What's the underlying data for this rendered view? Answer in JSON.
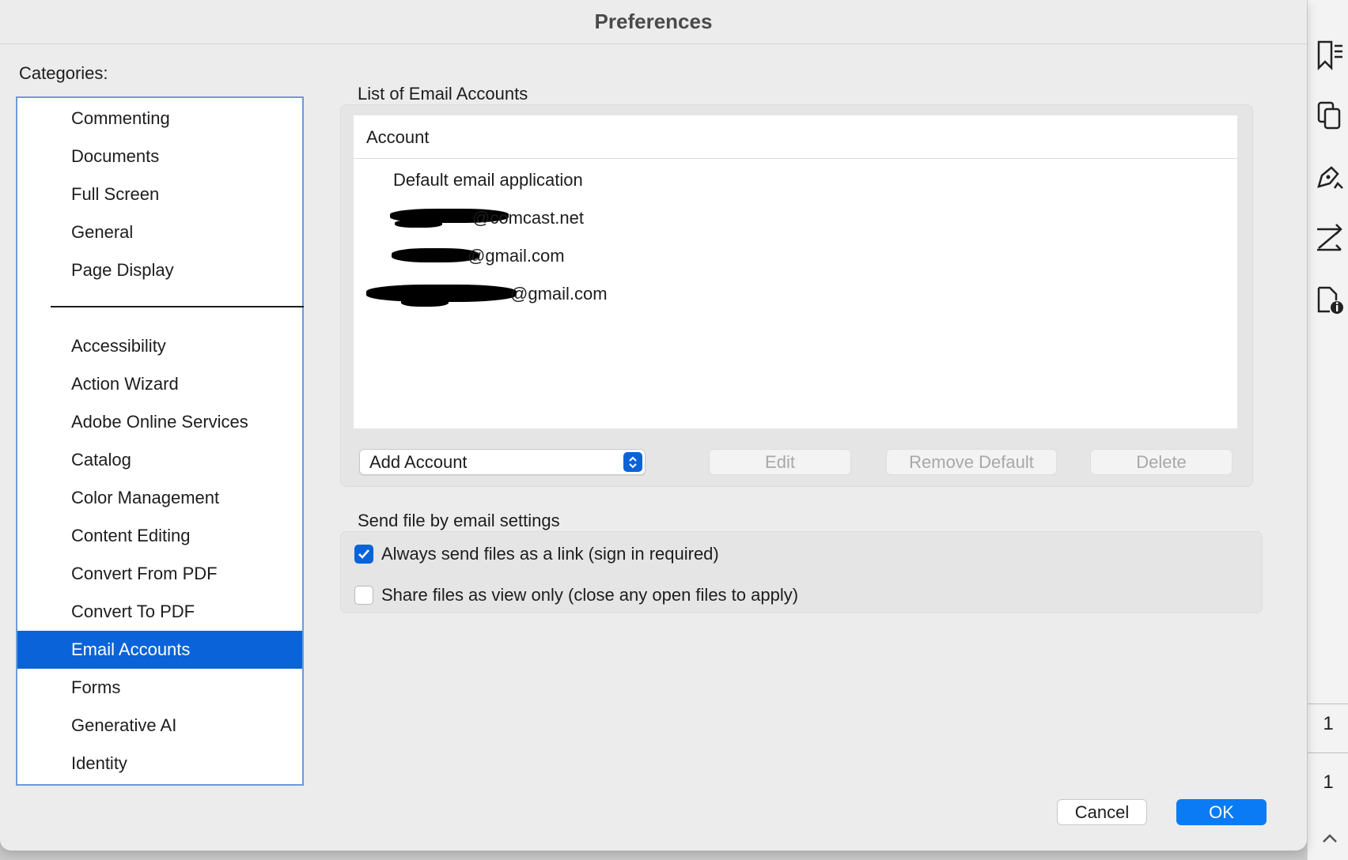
{
  "dialog": {
    "title": "Preferences"
  },
  "categories": {
    "label": "Categories:",
    "top_items": [
      "Commenting",
      "Documents",
      "Full Screen",
      "General",
      "Page Display"
    ],
    "items": [
      "Accessibility",
      "Action Wizard",
      "Adobe Online Services",
      "Catalog",
      "Color Management",
      "Content Editing",
      "Convert From PDF",
      "Convert To PDF",
      "Email Accounts",
      "Forms",
      "Generative AI",
      "Identity"
    ],
    "selected": "Email Accounts"
  },
  "email_accounts": {
    "section_label": "List of Email Accounts",
    "column_header": "Account",
    "rows": [
      "Default email application",
      "@comcast.net",
      "@gmail.com",
      "@gmail.com"
    ],
    "add_account": "Add Account",
    "edit": "Edit",
    "remove_default": "Remove Default",
    "delete": "Delete"
  },
  "send_settings": {
    "section_label": "Send file by email settings",
    "option1": {
      "label": "Always send files as a link (sign in required)",
      "checked": true
    },
    "option2": {
      "label": "Share files as view only (close any open files to apply)",
      "checked": false
    }
  },
  "footer": {
    "cancel": "Cancel",
    "ok": "OK"
  },
  "app_strip": {
    "icons": [
      "bookmark-icon",
      "pages-icon",
      "sign-icon",
      "compare-icon",
      "file-info-icon"
    ],
    "page_numbers": [
      "1",
      "1"
    ]
  },
  "colors": {
    "accent": "#0a63d8",
    "ok_button": "#0a7bf5"
  }
}
